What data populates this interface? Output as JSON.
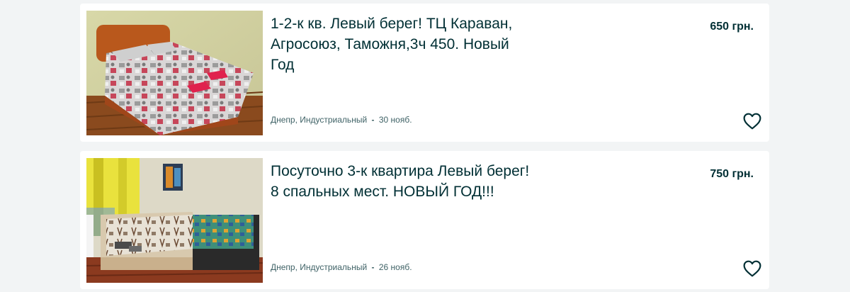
{
  "listings": [
    {
      "title": "1-2-к кв. Левый берег! ТЦ Караван, Агросоюз, Таможня,3ч 450. Новый Год",
      "price": "650 грн.",
      "location": "Днепр, Индустриальный",
      "separator": "-",
      "date": "30 нояб."
    },
    {
      "title": "Посуточно 3-к квартира Левый берег! 8 спальных мест. НОВЫЙ ГОД!!!",
      "price": "750 грн.",
      "location": "Днепр, Индустриальный",
      "separator": "-",
      "date": "26 нояб."
    }
  ],
  "icons": {
    "favorite": "heart-outline-icon"
  },
  "colors": {
    "text_primary": "#002f34",
    "text_secondary": "#406367",
    "card_bg": "#ffffff",
    "page_bg": "#f2f4f5"
  }
}
